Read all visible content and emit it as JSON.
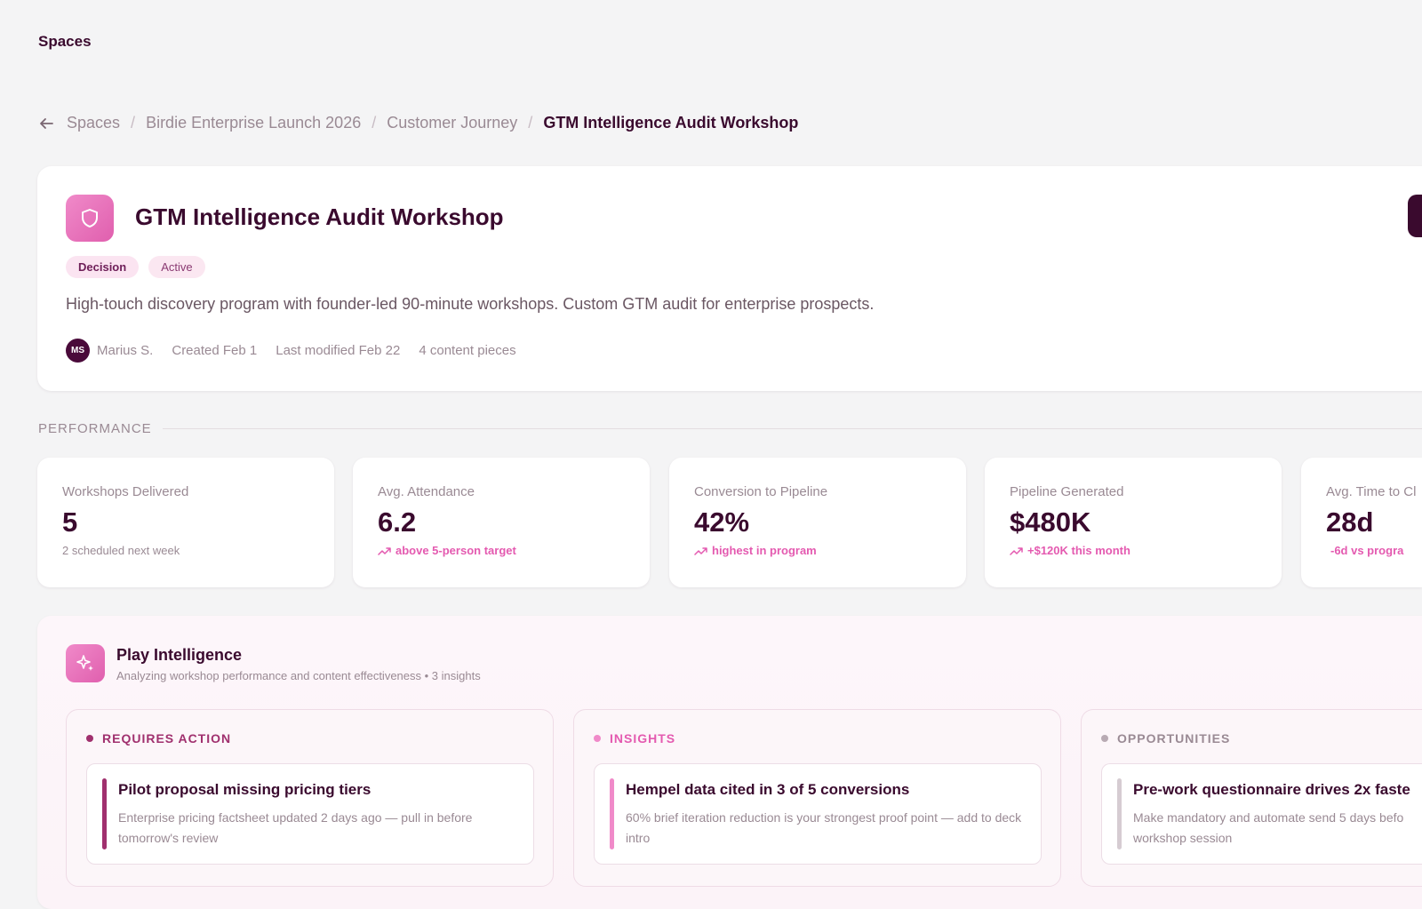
{
  "app": {
    "title": "Spaces"
  },
  "breadcrumb": {
    "items": [
      "Spaces",
      "Birdie Enterprise Launch 2026",
      "Customer Journey"
    ],
    "current": "GTM Intelligence Audit Workshop",
    "separator": "/"
  },
  "play": {
    "title": "GTM Intelligence Audit Workshop",
    "icon": "shield-icon",
    "tags": [
      "Decision",
      "Active"
    ],
    "description": "High-touch discovery program with founder-led 90-minute workshops. Custom GTM audit for enterprise prospects.",
    "owner_initials": "MS",
    "owner_name": "Marius S.",
    "created": "Created Feb 1",
    "modified": "Last modified Feb 22",
    "content_count": "4 content pieces"
  },
  "performance": {
    "label": "PERFORMANCE",
    "metrics": [
      {
        "label": "Workshops Delivered",
        "value": "5",
        "sub": "2 scheduled next week",
        "trend": "none"
      },
      {
        "label": "Avg. Attendance",
        "value": "6.2",
        "sub": "above 5-person target",
        "trend": "up"
      },
      {
        "label": "Conversion to Pipeline",
        "value": "42%",
        "sub": "highest in program",
        "trend": "up"
      },
      {
        "label": "Pipeline Generated",
        "value": "$480K",
        "sub": "+$120K this month",
        "trend": "up"
      },
      {
        "label": "Avg. Time to Cl",
        "value": "28d",
        "sub": "-6d vs progra",
        "trend": "down"
      }
    ]
  },
  "intelligence": {
    "title": "Play Intelligence",
    "subtitle": "Analyzing workshop performance and content effectiveness • 3 insights",
    "icon": "sparkles-icon",
    "columns": [
      {
        "heading": "REQUIRES ACTION",
        "color": "#a0306e",
        "bar_color": "#a0306e",
        "item_title": "Pilot proposal missing pricing tiers",
        "item_body": "Enterprise pricing factsheet updated 2 days ago — pull in before tomorrow's review"
      },
      {
        "heading": "INSIGHTS",
        "color": "#e45ab0",
        "bar_color": "#f08ac9",
        "item_title": "Hempel data cited in 3 of 5 conversions",
        "item_body": "60% brief iteration reduction is your strongest proof point — add to deck intro"
      },
      {
        "heading": "OPPORTUNITIES",
        "color": "#9a8a94",
        "bar_color": "#d6ccd2",
        "item_title": "Pre-work questionnaire drives 2x faste",
        "item_body": "Make mandatory and automate send 5 days befo workshop session"
      }
    ]
  },
  "colors": {
    "primary": "#3a0a2e",
    "accent": "#e45ab0",
    "muted": "#9a8a94"
  }
}
